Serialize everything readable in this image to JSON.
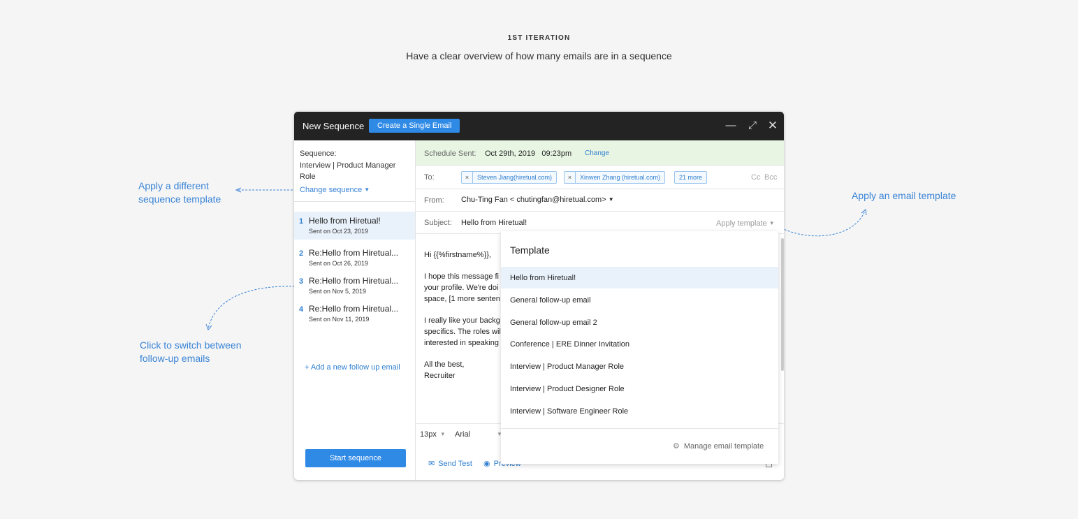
{
  "header": {
    "label": "1ST ITERATION",
    "subtitle": "Have a clear overview of how many emails are in a sequence"
  },
  "annotations": {
    "sequence_template": "Apply a different sequence template",
    "switch_emails": "Click to switch between follow-up emails",
    "email_template": "Apply an email template"
  },
  "window": {
    "title": "New Sequence",
    "create_single": "Create a Single Email"
  },
  "sequence": {
    "label": "Sequence:",
    "name": "Interview | Product Manager Role",
    "change": "Change sequence"
  },
  "emails": [
    {
      "num": "1",
      "subject": "Hello from Hiretual!",
      "date": "Sent on Oct 23, 2019",
      "active": true
    },
    {
      "num": "2",
      "subject": "Re:Hello from Hiretual...",
      "date": "Sent on Oct 26, 2019",
      "active": false
    },
    {
      "num": "3",
      "subject": "Re:Hello from Hiretual...",
      "date": "Sent on Nov 5, 2019",
      "active": false
    },
    {
      "num": "4",
      "subject": "Re:Hello from Hiretual...",
      "date": "Sent on Nov 11, 2019",
      "active": false
    }
  ],
  "add_followup": "+ Add a new follow up email",
  "start_sequence": "Start sequence",
  "schedule": {
    "label": "Schedule Sent:",
    "value": "Oct 29th, 2019   09:23pm",
    "change": "Change"
  },
  "to": {
    "label": "To:",
    "recipients": [
      "Steven Jiang(hiretual.com)",
      "Xinwen Zhang (hiretual.com)"
    ],
    "more": "21 more",
    "cc": "Cc",
    "bcc": "Bcc"
  },
  "from": {
    "label": "From:",
    "value": "Chu-Ting Fan < chutingfan@hiretual.com>"
  },
  "subject": {
    "label": "Subject:",
    "value": "Hello from Hiretual!",
    "apply_template": "Apply template"
  },
  "body": {
    "greeting": "Hi {{%firstname%}},",
    "p1": "I hope this message fi your profile. We're doi space, [1 more senten",
    "p2": "I really like your backg specifics. The roles wil interested in speaking",
    "closing": "All the best,",
    "signature": "Recruiter"
  },
  "toolbar": {
    "font_size": "13px",
    "font_family": "Arial"
  },
  "actions": {
    "send_test": "Send Test",
    "preview": "Preview"
  },
  "template_dropdown": {
    "title": "Template",
    "items": [
      "Hello from Hiretual!",
      "General follow-up email",
      "General follow-up email 2",
      "Conference | ERE Dinner Invitation",
      "Interview | Product Manager Role",
      "Interview | Product Designer Role",
      "Interview | Software Engineer Role"
    ],
    "manage": "Manage email template"
  }
}
